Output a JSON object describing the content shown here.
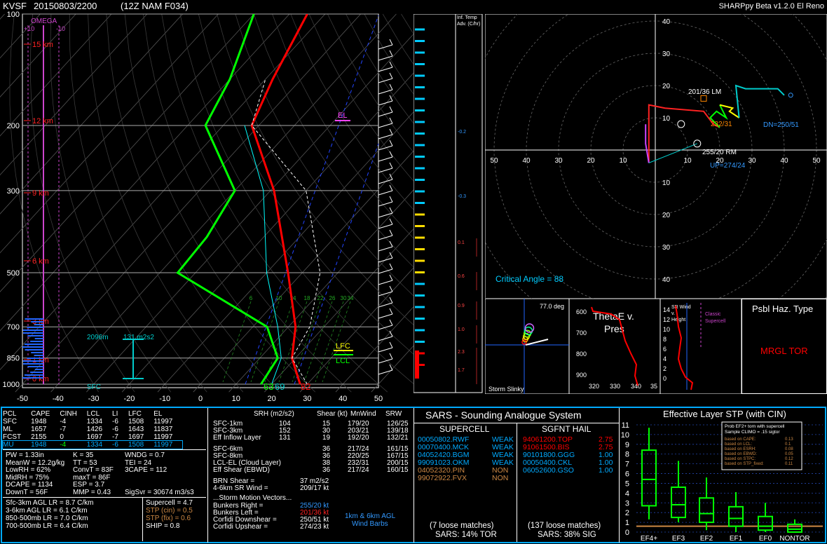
{
  "header": {
    "station": "KVSF",
    "datetime": "20150803/2200",
    "model": "(12Z  NAM  F034)",
    "app": "SHARPpy Beta v1.2.0 El Reno"
  },
  "skewt": {
    "omega_label": "OMEGA",
    "omega_ticks": [
      "+10",
      "-10"
    ],
    "pressure_ticks": [
      "100",
      "200",
      "300",
      "500",
      "700",
      "850",
      "1000"
    ],
    "temp_ticks": [
      "-50",
      "-40",
      "-30",
      "-20",
      "-10",
      "0",
      "10",
      "20",
      "30",
      "40",
      "50"
    ],
    "height_labels": [
      "15 km",
      "12 km",
      "9 km",
      "6 km",
      "3 km",
      "1 km",
      "0 km"
    ],
    "el_label": "EL",
    "lfc_label": "LFC",
    "lcl_label": "LCL",
    "sfc_label": "SFC",
    "eff_inflow_depth": "2096m",
    "eff_inflow_srh": "131 m2s2",
    "sfc_dewpoint": "63",
    "sfc_temp_wetbulb": "69",
    "sfc_temp": "82",
    "mixing_ratio_labels": [
      "6",
      "10",
      "14",
      "18",
      "22",
      "26",
      "30",
      "34"
    ],
    "colors": {
      "temp": "#ff0000",
      "dewpoint": "#00ff00",
      "virtual": "#ff0000",
      "parcel": "#ffffff",
      "isobar": "#ffffff"
    }
  },
  "chart_data": {
    "type": "line",
    "title": "",
    "xlabel": "",
    "ylabel": "",
    "xlim": [
      -50,
      50
    ],
    "ylim": [
      1000,
      100
    ],
    "series": [
      {
        "name": "",
        "values": [
          [
            1000,
            28
          ],
          [
            850,
            19
          ],
          [
            700,
            12
          ],
          [
            500,
            -4
          ],
          [
            300,
            -29
          ],
          [
            200,
            -52
          ],
          [
            150,
            -58
          ],
          [
            100,
            -65
          ]
        ]
      },
      {
        "name": "",
        "values": [
          [
            1000,
            17
          ],
          [
            850,
            15
          ],
          [
            700,
            4
          ],
          [
            500,
            -35
          ],
          [
            400,
            -36
          ],
          [
            300,
            -40
          ],
          [
            200,
            -65
          ],
          [
            150,
            -70
          ],
          [
            100,
            -80
          ]
        ]
      }
    ]
  },
  "advection": {
    "title_lines": [
      "Inf. Temp",
      "Adv. (C/hr)"
    ],
    "values": [
      "-0.2",
      "-0.3",
      "0.1",
      "0.6",
      "0.9",
      "1.0",
      "2.3",
      "1.7"
    ]
  },
  "hodograph": {
    "rings": [
      "10",
      "20",
      "30",
      "40",
      "50",
      "60"
    ],
    "x_ticks": [
      "70",
      "60",
      "50",
      "40",
      "30",
      "20",
      "10",
      "10",
      "20",
      "30",
      "40",
      "50",
      "60",
      "70"
    ],
    "labels": {
      "lm": "201/36 LM",
      "rm": "255/20 RM",
      "mean": "232/31",
      "dn": "DN=250/51",
      "up": "UP=274/24"
    },
    "critical_angle": "Critical Angle = 88"
  },
  "slinky": {
    "angle": "77.0 deg",
    "label": "Storm Slinky"
  },
  "thetae": {
    "title_lines": [
      "ThetaE v.",
      "Pres"
    ],
    "y_ticks": [
      "600",
      "700",
      "800",
      "900"
    ],
    "x_ticks": [
      "320",
      "330",
      "340",
      "35"
    ]
  },
  "srwind": {
    "title_lines": [
      "SR Wind",
      "v.",
      "Height"
    ],
    "y_ticks": [
      "14",
      "12",
      "10",
      "8",
      "6",
      "4",
      "2",
      "0"
    ],
    "classic": [
      "Classic",
      "Supercell"
    ]
  },
  "hazard": {
    "title": "Psbl Haz. Type",
    "value": "MRGL TOR"
  },
  "parcels": {
    "headers": [
      "PCL",
      "CAPE",
      "CINH",
      "LCL",
      "LI",
      "LFC",
      "EL"
    ],
    "rows": [
      [
        "SFC",
        "1948",
        "-4",
        "1334",
        "-6",
        "1508",
        "11997"
      ],
      [
        "ML",
        "1657",
        "-7",
        "1426",
        "-6",
        "1643",
        "11837"
      ],
      [
        "FCST",
        "2155",
        "0",
        "1697",
        "-7",
        "1697",
        "11997"
      ],
      [
        "MU",
        "1948",
        "-4",
        "1334",
        "-6",
        "1508",
        "11997"
      ]
    ]
  },
  "indices": {
    "col1": [
      "PW = 1.33in",
      "MeanW = 12.2g/kg",
      "LowRH = 62%",
      "MidRH = 75%",
      "DCAPE = 1134",
      "DownT = 56F"
    ],
    "col2": [
      "K = 35",
      "TT = 53",
      "ConvT = 83F",
      "maxT = 86F",
      "ESP = 3.7",
      "MMP = 0.43"
    ],
    "col3": [
      "WNDG = 0.7",
      "TEI = 24",
      "3CAPE = 112",
      "",
      "",
      "SigSvr = 30674 m3/s3"
    ]
  },
  "lapse_rates": [
    "Sfc-3km AGL LR = 8.7 C/km",
    "3-6km AGL LR = 6.1 C/km",
    "850-500mb LR = 7.0 C/km",
    "700-500mb LR = 6.4 C/km"
  ],
  "composites": {
    "supercell": "Supercell = 4.7",
    "stp_cin": "STP (cin) = 0.5",
    "stp_fix": "STP (fix) = 0.6",
    "ship": "SHIP = 0.8"
  },
  "kinematics": {
    "headers": [
      "SRH (m2/s2)",
      "Shear (kt)",
      "MnWind",
      "SRW"
    ],
    "rows": [
      [
        "SFC-1km",
        "104",
        "15",
        "179/20",
        "126/25"
      ],
      [
        "SFC-3km",
        "152",
        "30",
        "203/21",
        "139/18"
      ],
      [
        "Eff Inflow Layer",
        "131",
        "19",
        "192/20",
        "132/21"
      ],
      [
        "SFC-6km",
        "",
        "36",
        "217/24",
        "161/15"
      ],
      [
        "SFC-8km",
        "",
        "36",
        "220/25",
        "167/15"
      ],
      [
        "LCL-EL (Cloud Layer)",
        "",
        "38",
        "232/31",
        "200/15"
      ],
      [
        "Eff Shear (EBWD)",
        "",
        "36",
        "217/24",
        "160/15"
      ]
    ],
    "brn_shear": [
      "BRN Shear =",
      "37 m2/s2"
    ],
    "sr_wind_46": [
      "4-6km SR Wind =",
      "209/17 kt"
    ],
    "storm_motion_title": "...Storm Motion Vectors...",
    "storm_motion": [
      [
        "Bunkers Right =",
        "255/20 kt"
      ],
      [
        "Bunkers Left =",
        "201/36 kt"
      ],
      [
        "Corfidi Downshear =",
        "250/51 kt"
      ],
      [
        "Corfidi Upshear =",
        "274/23 kt"
      ]
    ],
    "barbs_label": [
      "1km & 6km AGL",
      "Wind Barbs"
    ]
  },
  "sars": {
    "title": "SARS - Sounding Analogue System",
    "supercell_title": "SUPERCELL",
    "hail_title": "SGFNT HAIL",
    "supercell": [
      [
        "00050802.RWF",
        "WEAK",
        "#00aaff"
      ],
      [
        "00070400.MCK",
        "WEAK",
        "#00aaff"
      ],
      [
        "04052420.BGM",
        "WEAK",
        "#00aaff"
      ],
      [
        "99091023.OKM",
        "WEAK",
        "#00aaff"
      ],
      [
        "04052320.PIN",
        "NON",
        "#cc8844"
      ],
      [
        "99072922.FVX",
        "NON",
        "#cc8844"
      ]
    ],
    "hail": [
      [
        "94061200.TOP",
        "2.75",
        "#ff0000"
      ],
      [
        "91061500.BIS",
        "2.75",
        "#ff0000"
      ],
      [
        "90101800.GGG",
        "1.00",
        "#00aaff"
      ],
      [
        "00050400.CKL",
        "1.00",
        "#00aaff"
      ],
      [
        "06052600.GSO",
        "1.00",
        "#00aaff"
      ]
    ],
    "supercell_matches": "(7 loose matches)",
    "supercell_pct": "SARS: 14% TOR",
    "hail_matches": "(137 loose matches)",
    "hail_pct": "SARS: 38% SIG"
  },
  "stp": {
    "title": "Effective Layer STP (with CIN)",
    "y_ticks": [
      "0",
      "1",
      "2",
      "3",
      "4",
      "5",
      "6",
      "7",
      "8",
      "9",
      "10",
      "11"
    ],
    "categories": [
      "EF4+",
      "EF3",
      "EF2",
      "EF1",
      "EF0",
      "NONTOR"
    ],
    "legend_title": [
      "Prob EF2+ torn with supercell",
      "Sample CLIMO = .15 sigtor"
    ],
    "legend_rows": [
      [
        "based on CAPE:",
        "0.13"
      ],
      [
        "based on LCL:",
        "0.1"
      ],
      [
        "based on ESRH:",
        "0.08"
      ],
      [
        "based on EBWD:",
        "0.05"
      ],
      [
        "based on STPC:",
        "0.12"
      ],
      [
        "based on STP_fixed:",
        "0.11"
      ]
    ],
    "boxes": [
      {
        "min": 1.3,
        "q1": 2.7,
        "med": 5.4,
        "q3": 8.4,
        "max": 10.7
      },
      {
        "min": 1.0,
        "q1": 1.5,
        "med": 2.8,
        "q3": 4.6,
        "max": 7.3
      },
      {
        "min": 0.2,
        "q1": 1.0,
        "med": 1.9,
        "q3": 3.5,
        "max": 5.6
      },
      {
        "min": 0.0,
        "q1": 0.6,
        "med": 1.4,
        "q3": 2.6,
        "max": 4.1
      },
      {
        "min": 0.0,
        "q1": 0.2,
        "med": 0.6,
        "q3": 1.6,
        "max": 3.0
      },
      {
        "min": 0.0,
        "q1": 0.0,
        "med": 0.3,
        "q3": 0.8,
        "max": 1.3
      }
    ],
    "current_value": 0.6
  }
}
